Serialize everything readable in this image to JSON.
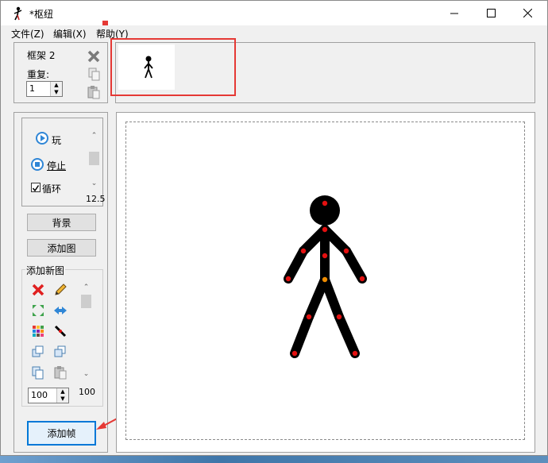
{
  "window": {
    "title": "*枢纽"
  },
  "menu": {
    "items": [
      "文件(Z)",
      "编辑(X)",
      "帮助(Y)"
    ]
  },
  "frame_panel": {
    "frame_label": "框架 2",
    "repeat_label": "重复:",
    "repeat_value": "1"
  },
  "playback": {
    "play_label": "玩",
    "stop_label": "停止",
    "loop_label": "循环",
    "loop_checked": true,
    "fps_value": "12.5"
  },
  "buttons": {
    "background_label": "背景",
    "add_figure_label": "添加图",
    "add_new_figure_group": "添加新图",
    "add_frame_label": "添加帧"
  },
  "figure_tools": {
    "scale_value": "100",
    "scroll_value": "100",
    "icons": [
      "delete-icon",
      "pencil-icon",
      "center-icon",
      "flip-icon",
      "color-palette-icon",
      "join-icon",
      "bring-front-icon",
      "send-back-icon",
      "copy-icon",
      "paste-icon"
    ]
  },
  "colors": {
    "accent_red": "#e53935",
    "joint_red": "#e41010",
    "joint_orange": "#f08c00"
  }
}
